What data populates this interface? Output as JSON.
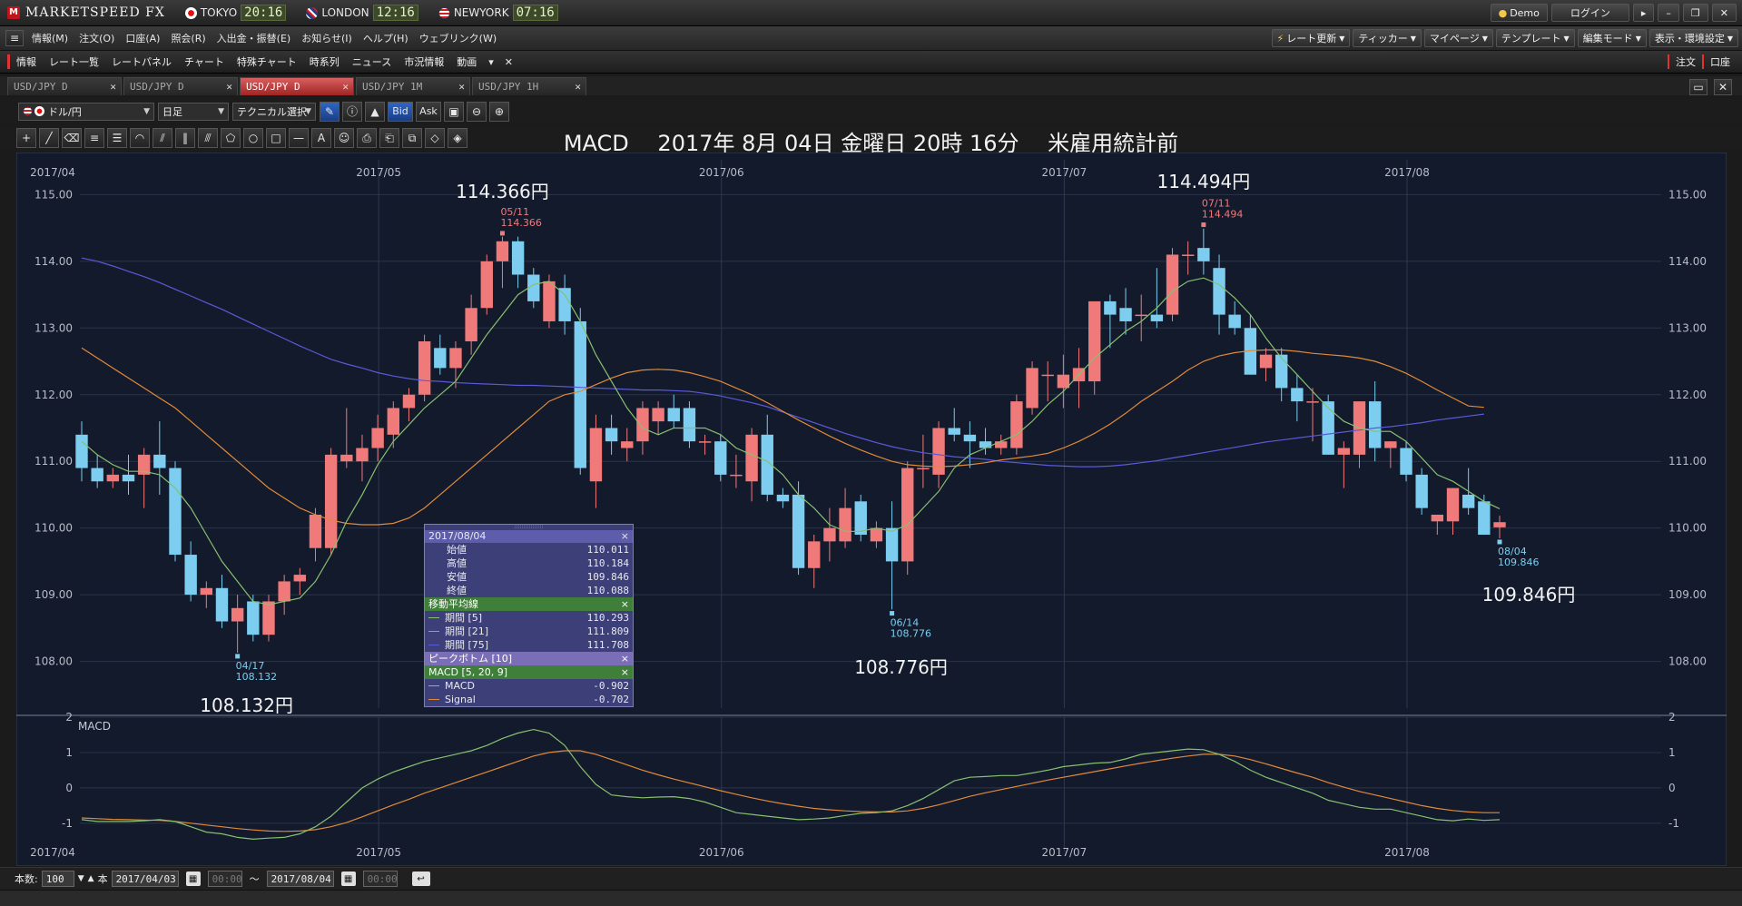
{
  "app": {
    "logo_mark": "M",
    "logo_text": "MARKETSPEED FX",
    "clocks": [
      {
        "city": "TOKYO",
        "time": "20:16",
        "flag": "jp"
      },
      {
        "city": "LONDON",
        "time": "12:16",
        "flag": "uk"
      },
      {
        "city": "NEWYORK",
        "time": "07:16",
        "flag": "us"
      }
    ],
    "demo_label": "Demo",
    "login_label": "ログイン",
    "window_controls": [
      "minimize-icon",
      "restore-icon",
      "close-icon"
    ]
  },
  "menu": {
    "items": [
      "情報(M)",
      "注文(O)",
      "口座(A)",
      "照会(R)",
      "入出金・振替(E)",
      "お知らせ(I)",
      "ヘルプ(H)",
      "ウェブリンク(W)"
    ],
    "right_items": [
      "レート更新",
      "ティッカー",
      "マイページ",
      "テンプレート",
      "編集モード",
      "表示・環境設定"
    ]
  },
  "ribbon": {
    "items": [
      "情報",
      "レート一覧",
      "レートパネル",
      "チャート",
      "特殊チャート",
      "時系列",
      "ニュース",
      "市況情報",
      "動画"
    ],
    "right_items": [
      "注文",
      "口座"
    ]
  },
  "tabs": [
    {
      "label": "USD/JPY D",
      "active": false
    },
    {
      "label": "USD/JPY D",
      "active": false
    },
    {
      "label": "USD/JPY D",
      "active": true
    },
    {
      "label": "USD/JPY 1M",
      "active": false
    },
    {
      "label": "USD/JPY 1H",
      "active": false
    }
  ],
  "toolbar": {
    "currency": "ドル/円",
    "period": "日足",
    "technical": "テクニカル選択",
    "bid": "Bid",
    "ask": "Ask"
  },
  "heading": {
    "indicator": "MACD",
    "datetime": "2017年 8月 04日 金曜日 20時 16分",
    "note": "米雇用統計前"
  },
  "annotations": {
    "peak1": "114.366円",
    "peak2": "114.494円",
    "trough1": "108.132円",
    "trough2": "108.776円",
    "last": "109.846円"
  },
  "data_window": {
    "date": "2017/08/04",
    "ohlc": [
      {
        "label": "始値",
        "value": "110.011"
      },
      {
        "label": "高値",
        "value": "110.184"
      },
      {
        "label": "安値",
        "value": "109.846"
      },
      {
        "label": "終値",
        "value": "110.088"
      }
    ],
    "ma_title": "移動平均線",
    "ma": [
      {
        "label": "期間 [5]",
        "value": "110.293",
        "color": "#88c070"
      },
      {
        "label": "期間 [21]",
        "value": "111.809",
        "color": "#e08a3a"
      },
      {
        "label": "期間 [75]",
        "value": "111.708",
        "color": "#5a5ad8"
      }
    ],
    "peak_title": "ピークボトム [10]",
    "macd_title": "MACD [5, 20, 9]",
    "macd": [
      {
        "label": "MACD",
        "value": "-0.902",
        "color": "#88c070"
      },
      {
        "label": "Signal",
        "value": "-0.702",
        "color": "#e08a3a"
      }
    ]
  },
  "bottom": {
    "count_label": "本数:",
    "count_value": "100",
    "unit": "本",
    "from": "2017/04/03",
    "to": "2017/08/04",
    "from_time": "00:00",
    "to_time": "00:00",
    "tilde": "～"
  },
  "chart_data": {
    "type": "candlestick",
    "x_labels": [
      "2017/04",
      "2017/05",
      "2017/06",
      "2017/07",
      "2017/08"
    ],
    "price_ticks": [
      "115.00",
      "114.00",
      "113.00",
      "112.00",
      "111.00",
      "110.00",
      "109.00",
      "108.00"
    ],
    "ylim": [
      107.3,
      115.4
    ],
    "macd_ticks": [
      "2",
      "1",
      "0",
      "-1"
    ],
    "macd_ylim": [
      -1.8,
      2.0
    ],
    "macd_label": "MACD",
    "colors": {
      "up": "#f07a7a",
      "down": "#7ccdef",
      "ma5": "#88c070",
      "ma21": "#e08a3a",
      "ma75": "#5a5ad8",
      "macd": "#88c070",
      "signal": "#e08a3a"
    },
    "candles": [
      {
        "o": 111.4,
        "h": 111.6,
        "l": 110.7,
        "c": 110.9
      },
      {
        "o": 110.9,
        "h": 111.1,
        "l": 110.6,
        "c": 110.7
      },
      {
        "o": 110.7,
        "h": 110.9,
        "l": 110.6,
        "c": 110.8
      },
      {
        "o": 110.8,
        "h": 111.1,
        "l": 110.5,
        "c": 110.7
      },
      {
        "o": 110.8,
        "h": 111.2,
        "l": 110.3,
        "c": 111.1
      },
      {
        "o": 111.1,
        "h": 111.6,
        "l": 110.5,
        "c": 110.9
      },
      {
        "o": 110.9,
        "h": 111.0,
        "l": 109.5,
        "c": 109.6
      },
      {
        "o": 109.6,
        "h": 109.8,
        "l": 108.9,
        "c": 109.0
      },
      {
        "o": 109.0,
        "h": 109.2,
        "l": 108.8,
        "c": 109.1
      },
      {
        "o": 109.1,
        "h": 109.3,
        "l": 108.5,
        "c": 108.6
      },
      {
        "o": 108.6,
        "h": 109.0,
        "l": 108.13,
        "c": 108.8
      },
      {
        "o": 108.9,
        "h": 109.0,
        "l": 108.3,
        "c": 108.4
      },
      {
        "o": 108.4,
        "h": 109.0,
        "l": 108.3,
        "c": 108.9
      },
      {
        "o": 108.9,
        "h": 109.3,
        "l": 108.7,
        "c": 109.2
      },
      {
        "o": 109.2,
        "h": 109.4,
        "l": 109.0,
        "c": 109.3
      },
      {
        "o": 109.7,
        "h": 110.3,
        "l": 109.5,
        "c": 110.2
      },
      {
        "o": 109.7,
        "h": 111.2,
        "l": 109.6,
        "c": 111.1
      },
      {
        "o": 111.0,
        "h": 111.8,
        "l": 110.9,
        "c": 111.1
      },
      {
        "o": 111.0,
        "h": 111.4,
        "l": 110.7,
        "c": 111.2
      },
      {
        "o": 111.2,
        "h": 111.7,
        "l": 111.0,
        "c": 111.5
      },
      {
        "o": 111.4,
        "h": 111.9,
        "l": 111.2,
        "c": 111.8
      },
      {
        "o": 111.8,
        "h": 112.1,
        "l": 111.6,
        "c": 112.0
      },
      {
        "o": 112.0,
        "h": 112.9,
        "l": 111.9,
        "c": 112.8
      },
      {
        "o": 112.7,
        "h": 112.9,
        "l": 112.3,
        "c": 112.4
      },
      {
        "o": 112.4,
        "h": 112.8,
        "l": 112.1,
        "c": 112.7
      },
      {
        "o": 112.8,
        "h": 113.5,
        "l": 112.6,
        "c": 113.3
      },
      {
        "o": 113.3,
        "h": 114.1,
        "l": 113.2,
        "c": 114.0
      },
      {
        "o": 114.0,
        "h": 114.37,
        "l": 113.6,
        "c": 114.3
      },
      {
        "o": 114.3,
        "h": 114.37,
        "l": 113.6,
        "c": 113.8
      },
      {
        "o": 113.8,
        "h": 113.9,
        "l": 113.3,
        "c": 113.4
      },
      {
        "o": 113.1,
        "h": 113.8,
        "l": 113.0,
        "c": 113.7
      },
      {
        "o": 113.6,
        "h": 113.8,
        "l": 112.9,
        "c": 113.1
      },
      {
        "o": 113.1,
        "h": 113.3,
        "l": 110.8,
        "c": 110.9
      },
      {
        "o": 110.7,
        "h": 111.7,
        "l": 110.3,
        "c": 111.5
      },
      {
        "o": 111.5,
        "h": 111.7,
        "l": 111.1,
        "c": 111.3
      },
      {
        "o": 111.2,
        "h": 111.5,
        "l": 111.0,
        "c": 111.3
      },
      {
        "o": 111.3,
        "h": 111.9,
        "l": 111.1,
        "c": 111.8
      },
      {
        "o": 111.6,
        "h": 111.9,
        "l": 111.4,
        "c": 111.8
      },
      {
        "o": 111.8,
        "h": 112.0,
        "l": 111.5,
        "c": 111.6
      },
      {
        "o": 111.8,
        "h": 111.9,
        "l": 111.2,
        "c": 111.3
      },
      {
        "o": 111.3,
        "h": 111.4,
        "l": 111.1,
        "c": 111.3
      },
      {
        "o": 111.3,
        "h": 111.4,
        "l": 110.7,
        "c": 110.8
      },
      {
        "o": 110.8,
        "h": 111.1,
        "l": 110.6,
        "c": 110.8
      },
      {
        "o": 110.7,
        "h": 111.5,
        "l": 110.4,
        "c": 111.4
      },
      {
        "o": 111.4,
        "h": 111.7,
        "l": 110.4,
        "c": 110.5
      },
      {
        "o": 110.5,
        "h": 110.6,
        "l": 110.3,
        "c": 110.4
      },
      {
        "o": 110.5,
        "h": 110.7,
        "l": 109.3,
        "c": 109.4
      },
      {
        "o": 109.4,
        "h": 109.9,
        "l": 109.1,
        "c": 109.8
      },
      {
        "o": 109.8,
        "h": 110.3,
        "l": 109.5,
        "c": 110.0
      },
      {
        "o": 109.8,
        "h": 110.6,
        "l": 109.7,
        "c": 110.3
      },
      {
        "o": 110.4,
        "h": 110.5,
        "l": 109.8,
        "c": 109.9
      },
      {
        "o": 109.8,
        "h": 110.1,
        "l": 109.7,
        "c": 110.0
      },
      {
        "o": 110.0,
        "h": 110.4,
        "l": 108.78,
        "c": 109.5
      },
      {
        "o": 109.5,
        "h": 111.0,
        "l": 109.3,
        "c": 110.9
      },
      {
        "o": 110.9,
        "h": 111.4,
        "l": 110.6,
        "c": 110.9
      },
      {
        "o": 110.8,
        "h": 111.6,
        "l": 110.6,
        "c": 111.5
      },
      {
        "o": 111.5,
        "h": 111.8,
        "l": 111.3,
        "c": 111.4
      },
      {
        "o": 111.4,
        "h": 111.6,
        "l": 110.9,
        "c": 111.3
      },
      {
        "o": 111.3,
        "h": 111.5,
        "l": 111.1,
        "c": 111.2
      },
      {
        "o": 111.2,
        "h": 111.4,
        "l": 111.1,
        "c": 111.3
      },
      {
        "o": 111.2,
        "h": 112.0,
        "l": 111.1,
        "c": 111.9
      },
      {
        "o": 111.8,
        "h": 112.5,
        "l": 111.7,
        "c": 112.4
      },
      {
        "o": 112.3,
        "h": 112.5,
        "l": 111.9,
        "c": 112.3
      },
      {
        "o": 112.1,
        "h": 112.6,
        "l": 111.8,
        "c": 112.3
      },
      {
        "o": 112.2,
        "h": 112.7,
        "l": 111.8,
        "c": 112.4
      },
      {
        "o": 112.2,
        "h": 113.4,
        "l": 112.0,
        "c": 113.4
      },
      {
        "o": 113.4,
        "h": 113.5,
        "l": 112.7,
        "c": 113.2
      },
      {
        "o": 113.3,
        "h": 113.6,
        "l": 112.9,
        "c": 113.1
      },
      {
        "o": 113.2,
        "h": 113.5,
        "l": 112.8,
        "c": 113.2
      },
      {
        "o": 113.2,
        "h": 113.9,
        "l": 113.0,
        "c": 113.1
      },
      {
        "o": 113.2,
        "h": 114.2,
        "l": 113.1,
        "c": 114.1
      },
      {
        "o": 114.1,
        "h": 114.3,
        "l": 113.8,
        "c": 114.1
      },
      {
        "o": 114.2,
        "h": 114.49,
        "l": 113.8,
        "c": 114.0
      },
      {
        "o": 113.9,
        "h": 114.1,
        "l": 112.9,
        "c": 113.2
      },
      {
        "o": 113.2,
        "h": 113.4,
        "l": 112.9,
        "c": 113.0
      },
      {
        "o": 113.0,
        "h": 113.2,
        "l": 112.3,
        "c": 112.3
      },
      {
        "o": 112.4,
        "h": 112.7,
        "l": 112.2,
        "c": 112.6
      },
      {
        "o": 112.6,
        "h": 112.7,
        "l": 111.9,
        "c": 112.1
      },
      {
        "o": 112.1,
        "h": 112.3,
        "l": 111.6,
        "c": 111.9
      },
      {
        "o": 111.9,
        "h": 112.1,
        "l": 111.3,
        "c": 111.9
      },
      {
        "o": 111.9,
        "h": 112.0,
        "l": 111.1,
        "c": 111.1
      },
      {
        "o": 111.1,
        "h": 111.3,
        "l": 110.6,
        "c": 111.2
      },
      {
        "o": 111.1,
        "h": 111.9,
        "l": 110.9,
        "c": 111.9
      },
      {
        "o": 111.9,
        "h": 112.2,
        "l": 111.0,
        "c": 111.2
      },
      {
        "o": 111.2,
        "h": 111.3,
        "l": 110.9,
        "c": 111.3
      },
      {
        "o": 111.2,
        "h": 111.3,
        "l": 110.7,
        "c": 110.8
      },
      {
        "o": 110.8,
        "h": 110.9,
        "l": 110.2,
        "c": 110.3
      },
      {
        "o": 110.1,
        "h": 110.2,
        "l": 109.9,
        "c": 110.2
      },
      {
        "o": 110.1,
        "h": 110.6,
        "l": 109.9,
        "c": 110.6
      },
      {
        "o": 110.5,
        "h": 110.9,
        "l": 110.2,
        "c": 110.3
      },
      {
        "o": 110.4,
        "h": 110.5,
        "l": 109.9,
        "c": 109.9
      },
      {
        "o": 110.011,
        "h": 110.184,
        "l": 109.846,
        "c": 110.088
      }
    ],
    "ma5": [
      111.3,
      111.1,
      110.95,
      110.85,
      110.85,
      110.8,
      110.6,
      110.3,
      109.9,
      109.5,
      109.2,
      108.9,
      108.85,
      108.9,
      108.95,
      109.2,
      109.6,
      110.1,
      110.5,
      110.95,
      111.3,
      111.55,
      111.8,
      112.0,
      112.2,
      112.55,
      112.9,
      113.2,
      113.5,
      113.65,
      113.7,
      113.5,
      113.1,
      112.6,
      112.2,
      111.8,
      111.5,
      111.4,
      111.5,
      111.5,
      111.5,
      111.4,
      111.2,
      111.1,
      111.0,
      110.8,
      110.5,
      110.3,
      110.05,
      109.95,
      109.95,
      110.0,
      109.95,
      110.05,
      110.3,
      110.55,
      110.9,
      111.1,
      111.2,
      111.3,
      111.4,
      111.6,
      111.85,
      112.05,
      112.3,
      112.55,
      112.75,
      112.95,
      113.1,
      113.3,
      113.55,
      113.7,
      113.75,
      113.65,
      113.45,
      113.2,
      112.85,
      112.55,
      112.3,
      112.05,
      111.8,
      111.6,
      111.5,
      111.45,
      111.45,
      111.3,
      111.05,
      110.8,
      110.7,
      110.55,
      110.4,
      110.29
    ],
    "ma21": [
      112.7,
      112.55,
      112.4,
      112.25,
      112.1,
      111.95,
      111.8,
      111.6,
      111.4,
      111.2,
      111.0,
      110.8,
      110.6,
      110.45,
      110.3,
      110.2,
      110.12,
      110.07,
      110.05,
      110.05,
      110.07,
      110.15,
      110.3,
      110.5,
      110.7,
      110.9,
      111.1,
      111.3,
      111.5,
      111.7,
      111.9,
      112.0,
      112.05,
      112.15,
      112.25,
      112.33,
      112.37,
      112.38,
      112.37,
      112.33,
      112.27,
      112.2,
      112.1,
      112.0,
      111.88,
      111.75,
      111.62,
      111.5,
      111.38,
      111.27,
      111.17,
      111.08,
      111.0,
      110.95,
      110.93,
      110.92,
      110.93,
      110.95,
      110.98,
      111.02,
      111.05,
      111.08,
      111.12,
      111.2,
      111.3,
      111.42,
      111.56,
      111.72,
      111.9,
      112.05,
      112.2,
      112.37,
      112.5,
      112.58,
      112.63,
      112.66,
      112.67,
      112.67,
      112.65,
      112.62,
      112.6,
      112.58,
      112.55,
      112.5,
      112.42,
      112.32,
      112.2,
      112.07,
      111.95,
      111.83,
      111.81
    ],
    "ma75": [
      114.05,
      114.0,
      113.93,
      113.85,
      113.77,
      113.68,
      113.58,
      113.48,
      113.38,
      113.28,
      113.17,
      113.06,
      112.95,
      112.84,
      112.73,
      112.63,
      112.53,
      112.46,
      112.4,
      112.33,
      112.28,
      112.24,
      112.21,
      112.2,
      112.18,
      112.17,
      112.16,
      112.15,
      112.14,
      112.14,
      112.13,
      112.12,
      112.11,
      112.1,
      112.09,
      112.08,
      112.07,
      112.07,
      112.06,
      112.05,
      112.02,
      111.98,
      111.93,
      111.88,
      111.82,
      111.74,
      111.66,
      111.58,
      111.5,
      111.42,
      111.35,
      111.28,
      111.22,
      111.17,
      111.13,
      111.1,
      111.07,
      111.05,
      111.03,
      111.0,
      110.98,
      110.96,
      110.94,
      110.93,
      110.92,
      110.92,
      110.93,
      110.95,
      110.98,
      111.01,
      111.05,
      111.09,
      111.13,
      111.17,
      111.21,
      111.25,
      111.29,
      111.32,
      111.35,
      111.38,
      111.41,
      111.44,
      111.47,
      111.5,
      111.52,
      111.55,
      111.58,
      111.62,
      111.65,
      111.68,
      111.71
    ],
    "macd": [
      -0.9,
      -0.95,
      -0.95,
      -0.95,
      -0.93,
      -0.9,
      -0.95,
      -1.1,
      -1.25,
      -1.3,
      -1.4,
      -1.45,
      -1.42,
      -1.4,
      -1.3,
      -1.1,
      -0.8,
      -0.4,
      0.0,
      0.25,
      0.45,
      0.6,
      0.75,
      0.85,
      0.95,
      1.05,
      1.2,
      1.4,
      1.55,
      1.65,
      1.55,
      1.2,
      0.6,
      0.1,
      -0.2,
      -0.25,
      -0.28,
      -0.26,
      -0.25,
      -0.3,
      -0.4,
      -0.55,
      -0.7,
      -0.75,
      -0.8,
      -0.85,
      -0.9,
      -0.88,
      -0.85,
      -0.78,
      -0.72,
      -0.7,
      -0.65,
      -0.5,
      -0.3,
      -0.05,
      0.2,
      0.3,
      0.32,
      0.35,
      0.35,
      0.42,
      0.5,
      0.6,
      0.65,
      0.7,
      0.72,
      0.82,
      0.95,
      1.0,
      1.05,
      1.1,
      1.08,
      0.95,
      0.75,
      0.5,
      0.3,
      0.15,
      0.0,
      -0.15,
      -0.35,
      -0.45,
      -0.55,
      -0.6,
      -0.6,
      -0.7,
      -0.8,
      -0.9,
      -0.93,
      -0.88,
      -0.92,
      -0.9
    ],
    "signal": [
      -0.85,
      -0.87,
      -0.89,
      -0.9,
      -0.91,
      -0.92,
      -0.95,
      -1.0,
      -1.05,
      -1.1,
      -1.15,
      -1.19,
      -1.22,
      -1.23,
      -1.22,
      -1.18,
      -1.1,
      -0.98,
      -0.82,
      -0.65,
      -0.48,
      -0.32,
      -0.15,
      0.0,
      0.15,
      0.3,
      0.45,
      0.6,
      0.75,
      0.9,
      1.0,
      1.05,
      1.05,
      0.95,
      0.8,
      0.65,
      0.5,
      0.37,
      0.25,
      0.14,
      0.03,
      -0.08,
      -0.18,
      -0.28,
      -0.37,
      -0.45,
      -0.52,
      -0.58,
      -0.62,
      -0.65,
      -0.67,
      -0.68,
      -0.68,
      -0.65,
      -0.58,
      -0.48,
      -0.36,
      -0.24,
      -0.14,
      -0.05,
      0.04,
      0.13,
      0.22,
      0.3,
      0.38,
      0.46,
      0.54,
      0.62,
      0.7,
      0.77,
      0.84,
      0.9,
      0.95,
      0.95,
      0.9,
      0.8,
      0.68,
      0.55,
      0.42,
      0.3,
      0.15,
      0.02,
      -0.1,
      -0.2,
      -0.3,
      -0.4,
      -0.5,
      -0.58,
      -0.64,
      -0.68,
      -0.7,
      -0.702
    ]
  }
}
